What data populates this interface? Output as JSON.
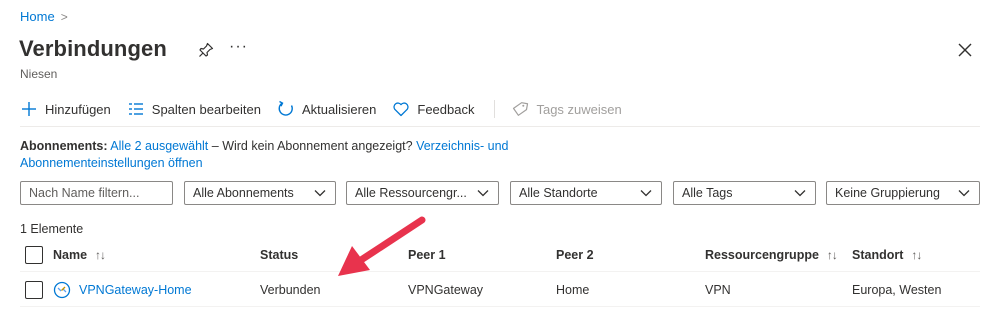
{
  "breadcrumb": {
    "home": "Home",
    "separator": ">"
  },
  "page": {
    "title": "Verbindungen",
    "subtitle": "Niesen",
    "more": "···"
  },
  "toolbar": {
    "add": "Hinzufügen",
    "edit_columns": "Spalten bearbeiten",
    "refresh": "Aktualisieren",
    "feedback": "Feedback",
    "assign_tags": "Tags zuweisen"
  },
  "subscriptions": {
    "label": "Abonnements:",
    "selected_link": "Alle 2 ausgewählt",
    "text": "– Wird kein Abonnement angezeigt?",
    "settings_link_1": "Verzeichnis- und",
    "settings_link_2": "Abonnementeinstellungen öffnen"
  },
  "filters": {
    "search_placeholder": "Nach Name filtern...",
    "subscriptions": "Alle Abonnements",
    "resource_groups": "Alle Ressourcengr...",
    "locations": "Alle Standorte",
    "tags": "Alle Tags",
    "grouping": "Keine Gruppierung"
  },
  "list": {
    "count": "1 Elemente",
    "columns": {
      "name": "Name",
      "status": "Status",
      "peer1": "Peer 1",
      "peer2": "Peer 2",
      "resource_group": "Ressourcengruppe",
      "location": "Standort"
    },
    "sort_glyph": "↑↓",
    "rows": [
      {
        "name": "VPNGateway-Home",
        "status": "Verbunden",
        "peer1": "VPNGateway",
        "peer2": "Home",
        "resource_group": "VPN",
        "location": "Europa, Westen"
      }
    ]
  },
  "colors": {
    "accent": "#0078d4",
    "annotation_arrow": "#e8334d"
  },
  "icons": [
    "chevron-right-icon",
    "pin-icon",
    "more-icon",
    "close-icon",
    "plus-icon",
    "columns-icon",
    "refresh-icon",
    "heart-icon",
    "tag-icon",
    "chevron-down-icon",
    "sort-icon",
    "connection-icon",
    "arrow-annotation"
  ]
}
